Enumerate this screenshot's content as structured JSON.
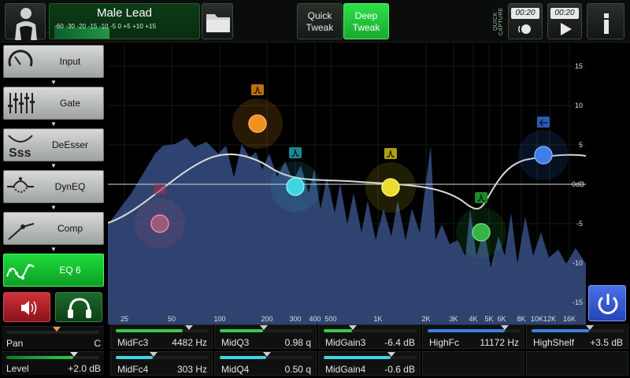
{
  "header": {
    "preset_name": "Male Lead",
    "meter_scale": "-60  -30  -20 -15  -10  -5   0   +5  +10 +15",
    "meter_level": 0.35,
    "quick_tweak": "Quick\nTweak",
    "quick_tweak_l1": "Quick",
    "quick_tweak_l2": "Tweak",
    "deep_tweak_l1": "Deep",
    "deep_tweak_l2": "Tweak",
    "quick_capture": "QUICK CAPTURE",
    "capture_time_1": "00:20",
    "capture_time_2": "00:20"
  },
  "sidebar": {
    "blocks": [
      {
        "label": "Input",
        "icon": "input-dial-icon"
      },
      {
        "label": "Gate",
        "icon": "gate-faders-icon"
      },
      {
        "label": "DeEsser",
        "icon": "deesser-sss-icon"
      },
      {
        "label": "DynEQ",
        "icon": "dyneq-icon"
      },
      {
        "label": "Comp",
        "icon": "compressor-curve-icon"
      },
      {
        "label": "EQ 6",
        "icon": "eq-curve-icon",
        "active": true
      }
    ],
    "pan": {
      "name": "Pan",
      "value": "C",
      "level": 0.5
    },
    "level": {
      "name": "Level",
      "value": "+2.0 dB",
      "level": 0.72
    }
  },
  "graph": {
    "db_ticks": [
      "15",
      "10",
      "5",
      "0dB",
      "-5",
      "-10",
      "-15"
    ],
    "freq_ticks": [
      "25",
      "50",
      "100",
      "200",
      "300",
      "400",
      "500",
      "1K",
      "2K",
      "3K",
      "4K",
      "5K",
      "6K",
      "8K",
      "10K",
      "12K",
      "16K"
    ]
  },
  "params": [
    {
      "name": "MidFc3",
      "value": "4482 Hz",
      "level": 0.72,
      "color": "#38c94a"
    },
    {
      "name": "MidQ3",
      "value": "0.98 q",
      "level": 0.33,
      "color": "#38c94a"
    },
    {
      "name": "MidGain3",
      "value": "-6.4 dB",
      "level": 0.33,
      "color": "#38c94a"
    },
    {
      "name": "HighFc",
      "value": "11172 Hz",
      "level": 0.83,
      "color": "#3d7ee8"
    },
    {
      "name": "HighShelf",
      "value": "+3.5 dB",
      "level": 0.62,
      "color": "#3d7ee8"
    },
    {
      "name": "MidFc4",
      "value": "303 Hz",
      "level": 0.4,
      "color": "#3fd3e0"
    },
    {
      "name": "MidQ4",
      "value": "0.50 q",
      "level": 0.5,
      "color": "#3fd3e0"
    },
    {
      "name": "MidGain4",
      "value": "-0.6 dB",
      "level": 0.72,
      "color": "#3fd3e0"
    }
  ]
}
